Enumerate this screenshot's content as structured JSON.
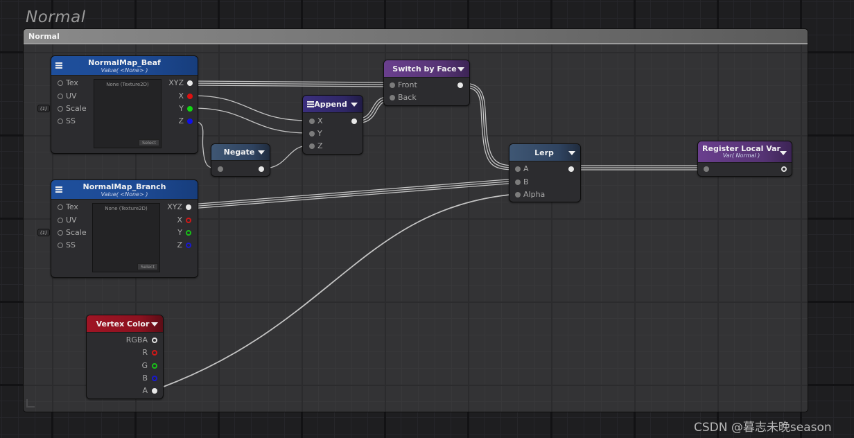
{
  "canvas": {
    "title": "Normal"
  },
  "group": {
    "title": "Normal"
  },
  "nodes": {
    "normalmap_beaf": {
      "title": "NormalMap_Beaf",
      "subtitle": "Value( <None> )",
      "inputs": [
        "Tex",
        "UV",
        "Scale",
        "SS"
      ],
      "outputs": [
        "XYZ",
        "X",
        "Y",
        "Z"
      ],
      "texture_label": "None (Texture2D)",
      "select_label": "Select",
      "scale_badge": "(1)"
    },
    "normalmap_branch": {
      "title": "NormalMap_Branch",
      "subtitle": "Value( <None> )",
      "inputs": [
        "Tex",
        "UV",
        "Scale",
        "SS"
      ],
      "outputs": [
        "XYZ",
        "X",
        "Y",
        "Z"
      ],
      "texture_label": "None (Texture2D)",
      "select_label": "Select",
      "scale_badge": "(1)"
    },
    "negate": {
      "title": "Negate"
    },
    "append": {
      "title": "Append",
      "inputs": [
        "X",
        "Y",
        "Z"
      ]
    },
    "switch_by_face": {
      "title": "Switch by Face",
      "inputs": [
        "Front",
        "Back"
      ]
    },
    "lerp": {
      "title": "Lerp",
      "inputs": [
        "A",
        "B",
        "Alpha"
      ]
    },
    "register_local_var": {
      "title": "Register Local Var",
      "subtitle": "Var( Normal )"
    },
    "vertex_color": {
      "title": "Vertex Color",
      "outputs": [
        "RGBA",
        "R",
        "G",
        "B",
        "A"
      ]
    }
  },
  "connections": [
    {
      "from": "NormalMap_Beaf.XYZ",
      "to": "Switch by Face.Front"
    },
    {
      "from": "NormalMap_Beaf.X",
      "to": "Append.X"
    },
    {
      "from": "NormalMap_Beaf.Y",
      "to": "Append.Y"
    },
    {
      "from": "NormalMap_Beaf.Z",
      "to": "Negate.In"
    },
    {
      "from": "Negate.Out",
      "to": "Append.Z"
    },
    {
      "from": "Append.Out",
      "to": "Switch by Face.Back"
    },
    {
      "from": "Switch by Face.Out",
      "to": "Lerp.A"
    },
    {
      "from": "NormalMap_Branch.XYZ",
      "to": "Lerp.B"
    },
    {
      "from": "Vertex Color.A",
      "to": "Lerp.Alpha"
    },
    {
      "from": "Lerp.Out",
      "to": "Register Local Var.In"
    }
  ],
  "colors": {
    "wire": "#c4c4c4",
    "port_red": "#e01010",
    "port_green": "#12d612",
    "port_blue": "#1010e8"
  },
  "watermark": "CSDN @暮志未晚season"
}
